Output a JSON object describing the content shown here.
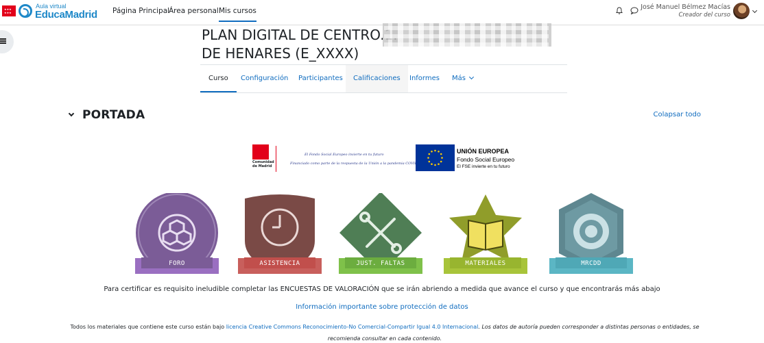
{
  "brand": {
    "subtitle": "Aula virtual",
    "name": "EducaMadrid"
  },
  "nav": {
    "home": "Página Principal",
    "personal": "Área personal",
    "courses": "Mis cursos"
  },
  "user": {
    "name": "José Manuel Bélmez Macías",
    "role": "Creador del curso"
  },
  "course": {
    "title_line1": "PLAN DIGITAL DE CENTRO.1.",
    "title_line2": "DE HENARES (E_XXXX)"
  },
  "tabs": [
    "Curso",
    "Configuración",
    "Participantes",
    "Calificaciones",
    "Informes",
    "Más"
  ],
  "section": {
    "title": "PORTADA",
    "collapse_all": "Colapsar todo"
  },
  "funding": {
    "cam_text": "Comunidad de Madrid",
    "script_line1": "El Fondo Social Europeo invierte en tu futuro",
    "script_line2": "Financiado como parte de la respuesta de la Unión a la pandemia COVID19",
    "eu_title": "UNIÓN EUROPEA",
    "eu_subtitle": "Fondo Social Europeo",
    "eu_tagline": "El FSE invierte en tu futuro"
  },
  "badges": [
    {
      "label": "FORO",
      "color": "#7b5c97",
      "ribbon": "#9a6fc1",
      "icon": "cubes-icon"
    },
    {
      "label": "ASISTENCIA",
      "color": "#7a4a46",
      "ribbon": "#c85f5c",
      "icon": "clock-icon"
    },
    {
      "label": "JUST. FALTAS",
      "color": "#4f7e55",
      "ribbon": "#7fc14a",
      "icon": "tools-icon"
    },
    {
      "label": "MATERIALES",
      "color": "#909d2a",
      "ribbon": "#a8c43a",
      "icon": "book-icon"
    },
    {
      "label": "MRCDD",
      "color": "#5e8790",
      "ribbon": "#5bb6c4",
      "icon": "target-icon"
    }
  ],
  "footer": {
    "requirement": "Para certificar es requisito ineludible completar las ENCUESTAS DE VALORACIÓN que se irán abriendo a medida que avance el curso y que encontrarás más abajo",
    "data_protection": "Información importante sobre protección de datos",
    "cc_prefix": "Todos los materiales que contiene este curso están bajo ",
    "cc_link": "licencia Creative Commons Reconocimiento-No Comercial-Compartir Igual 4.0 Internacional",
    "cc_suffix": ". Los datos de autoría pueden corresponder a distintas personas o entidades, se recomienda consultar en cada contenido."
  }
}
